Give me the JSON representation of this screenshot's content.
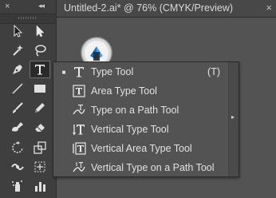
{
  "document": {
    "tab_title": "Untitled-2.ai* @ 76% (CMYK/Preview)",
    "close_glyph": "×"
  },
  "toolbar": {
    "close_glyph": "×",
    "collapse_glyph": "◂◂",
    "tools": [
      {
        "name": "selection-tool",
        "icon": "arrow-cursor-icon"
      },
      {
        "name": "direct-selection-tool",
        "icon": "white-arrow-icon"
      },
      {
        "name": "magic-wand-tool",
        "icon": "magic-wand-icon"
      },
      {
        "name": "lasso-tool",
        "icon": "lasso-icon"
      },
      {
        "name": "pen-tool",
        "icon": "pen-icon"
      },
      {
        "name": "type-tool",
        "icon": "type-t-icon",
        "active": true
      },
      {
        "name": "line-segment-tool",
        "icon": "line-icon"
      },
      {
        "name": "rectangle-tool",
        "icon": "rectangle-icon"
      },
      {
        "name": "paintbrush-tool",
        "icon": "brush-icon"
      },
      {
        "name": "pencil-tool",
        "icon": "pencil-icon"
      },
      {
        "name": "blob-brush-tool",
        "icon": "blob-brush-icon"
      },
      {
        "name": "eraser-tool",
        "icon": "eraser-icon"
      },
      {
        "name": "rotate-tool",
        "icon": "rotate-icon"
      },
      {
        "name": "scale-tool",
        "icon": "scale-icon"
      },
      {
        "name": "width-tool",
        "icon": "width-icon"
      },
      {
        "name": "free-transform-tool",
        "icon": "free-transform-icon"
      },
      {
        "name": "symbol-sprayer-tool",
        "icon": "symbol-sprayer-icon"
      },
      {
        "name": "column-graph-tool",
        "icon": "column-graph-icon"
      }
    ]
  },
  "flyout": {
    "expand_glyph": "▸",
    "items": [
      {
        "label": "Type Tool",
        "shortcut": "(T)",
        "selected": true,
        "icon": "type-tool-icon"
      },
      {
        "label": "Area Type Tool",
        "shortcut": "",
        "selected": false,
        "icon": "area-type-icon"
      },
      {
        "label": "Type on a Path Tool",
        "shortcut": "",
        "selected": false,
        "icon": "type-on-path-icon"
      },
      {
        "label": "Vertical Type Tool",
        "shortcut": "",
        "selected": false,
        "icon": "vertical-type-icon"
      },
      {
        "label": "Vertical Area Type Tool",
        "shortcut": "",
        "selected": false,
        "icon": "vertical-area-type-icon"
      },
      {
        "label": "Vertical Type on a Path Tool",
        "shortcut": "",
        "selected": false,
        "icon": "vertical-type-on-path-icon"
      }
    ],
    "bullet_glyph": "■"
  },
  "colors": {
    "panel": "#3f3f3f",
    "canvas": "#535353",
    "text": "#e2e2e2"
  }
}
